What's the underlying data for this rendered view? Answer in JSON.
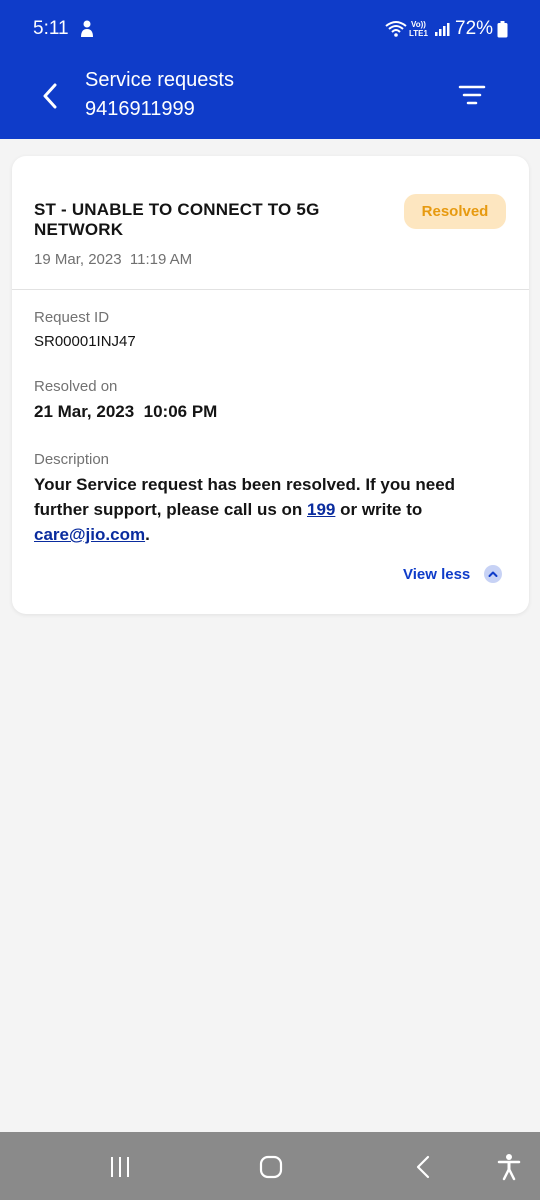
{
  "status_bar": {
    "time": "5:11",
    "network_label_top": "Vo))",
    "network_label_bottom": "LTE1",
    "battery": "72%"
  },
  "header": {
    "title": "Service requests",
    "subtitle": "9416911999"
  },
  "request": {
    "title": "ST - UNABLE TO CONNECT TO 5G NETWORK",
    "status": "Resolved",
    "date": "19 Mar, 2023  11:19 AM",
    "request_id_label": "Request ID",
    "request_id": "SR00001INJ47",
    "resolved_on_label": "Resolved on",
    "resolved_on": "21 Mar, 2023  10:06 PM",
    "description_label": "Description",
    "description_part1": "Your Service request has been resolved. If you need further support, please call us on ",
    "description_phone": "199",
    "description_part2": " or write to ",
    "description_email": "care@jio.com",
    "description_part3": ".",
    "view_less": "View less"
  },
  "colors": {
    "header_bg": "#0f3cc9",
    "badge_bg": "#fde6c0",
    "badge_text": "#e79a10",
    "link": "#0a2c9e"
  }
}
